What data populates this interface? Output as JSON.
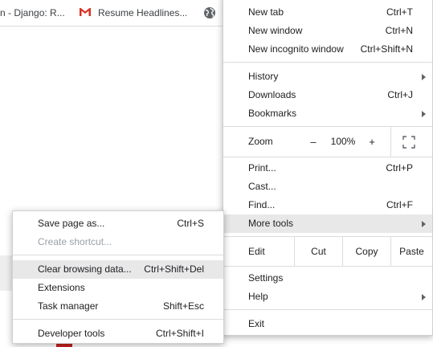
{
  "bookmarks": [
    {
      "label": "n - Django: R..."
    },
    {
      "label": "Resume Headlines..."
    }
  ],
  "main_menu": {
    "new_tab": {
      "label": "New tab",
      "shortcut": "Ctrl+T"
    },
    "new_window": {
      "label": "New window",
      "shortcut": "Ctrl+N"
    },
    "new_incognito": {
      "label": "New incognito window",
      "shortcut": "Ctrl+Shift+N"
    },
    "history": {
      "label": "History"
    },
    "downloads": {
      "label": "Downloads",
      "shortcut": "Ctrl+J"
    },
    "bookmarks": {
      "label": "Bookmarks"
    },
    "zoom": {
      "label": "Zoom",
      "minus": "–",
      "value": "100%",
      "plus": "+"
    },
    "print": {
      "label": "Print...",
      "shortcut": "Ctrl+P"
    },
    "cast": {
      "label": "Cast..."
    },
    "find": {
      "label": "Find...",
      "shortcut": "Ctrl+F"
    },
    "more_tools": {
      "label": "More tools"
    },
    "edit": {
      "label": "Edit",
      "cut": "Cut",
      "copy": "Copy",
      "paste": "Paste"
    },
    "settings": {
      "label": "Settings"
    },
    "help": {
      "label": "Help"
    },
    "exit": {
      "label": "Exit"
    }
  },
  "more_tools_menu": {
    "save_page": {
      "label": "Save page as...",
      "shortcut": "Ctrl+S"
    },
    "create_shortcut": {
      "label": "Create shortcut..."
    },
    "clear_browsing": {
      "label": "Clear browsing data...",
      "shortcut": "Ctrl+Shift+Del"
    },
    "extensions": {
      "label": "Extensions"
    },
    "task_manager": {
      "label": "Task manager",
      "shortcut": "Shift+Esc"
    },
    "developer_tools": {
      "label": "Developer tools",
      "shortcut": "Ctrl+Shift+I"
    }
  },
  "colors": {
    "gmail_red": "#d93025",
    "highlight": "#e8e8e9"
  }
}
